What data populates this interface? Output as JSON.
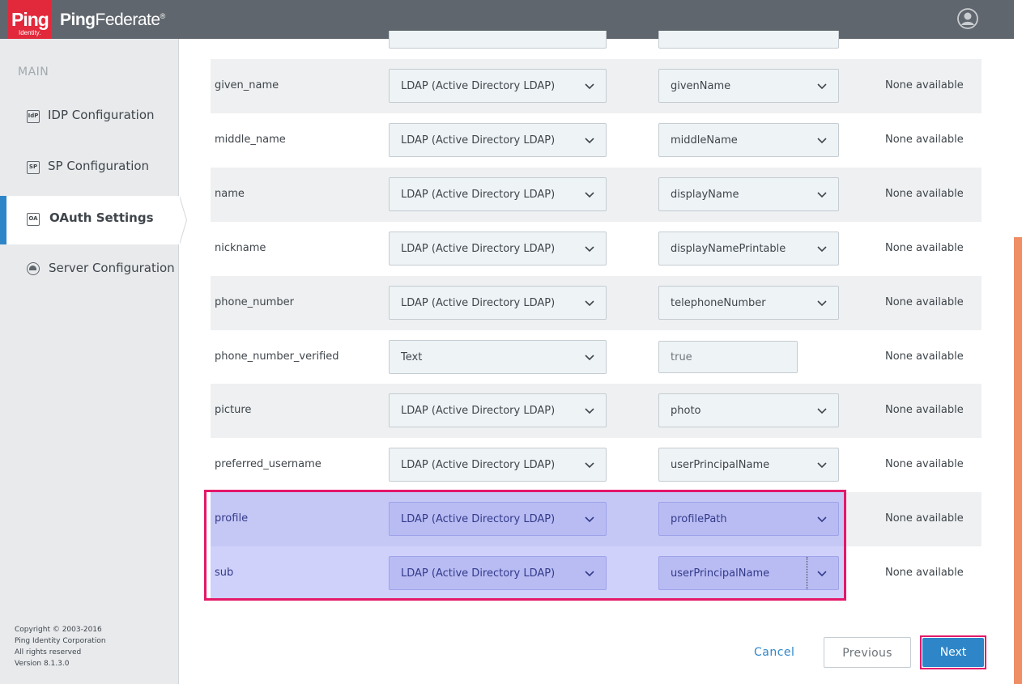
{
  "header": {
    "logo_main": "Ping",
    "logo_sub": "Identity.",
    "brand_ping": "Ping",
    "brand_federate": "Federate",
    "brand_mark": "®",
    "user_icon": "user-avatar-icon"
  },
  "sidebar": {
    "section_label": "MAIN",
    "items": [
      {
        "label": "IDP Configuration",
        "icon_text": "IdP",
        "active": false
      },
      {
        "label": "SP Configuration",
        "icon_text": "SP",
        "active": false
      },
      {
        "label": "OAuth Settings",
        "icon_text": "OA",
        "active": true
      },
      {
        "label": "Server Configuration",
        "icon": "server-icon",
        "active": false
      }
    ],
    "copyright": [
      "Copyright © 2003-2016",
      "Ping Identity Corporation",
      "All rights reserved",
      "Version 8.1.3.0"
    ]
  },
  "rows": [
    {
      "attr": "given_name",
      "source": "LDAP (Active Directory LDAP)",
      "value": "givenName",
      "value_type": "select",
      "status": "None available"
    },
    {
      "attr": "middle_name",
      "source": "LDAP (Active Directory LDAP)",
      "value": "middleName",
      "value_type": "select",
      "status": "None available"
    },
    {
      "attr": "name",
      "source": "LDAP (Active Directory LDAP)",
      "value": "displayName",
      "value_type": "select",
      "status": "None available"
    },
    {
      "attr": "nickname",
      "source": "LDAP (Active Directory LDAP)",
      "value": "displayNamePrintable",
      "value_type": "select",
      "status": "None available"
    },
    {
      "attr": "phone_number",
      "source": "LDAP (Active Directory LDAP)",
      "value": "telephoneNumber",
      "value_type": "select",
      "status": "None available"
    },
    {
      "attr": "phone_number_verified",
      "source": "Text",
      "value": "true",
      "value_type": "text",
      "status": "None available"
    },
    {
      "attr": "picture",
      "source": "LDAP (Active Directory LDAP)",
      "value": "photo",
      "value_type": "select",
      "status": "None available"
    },
    {
      "attr": "preferred_username",
      "source": "LDAP (Active Directory LDAP)",
      "value": "userPrincipalName",
      "value_type": "select",
      "status": "None available"
    },
    {
      "attr": "profile",
      "source": "LDAP (Active Directory LDAP)",
      "value": "profilePath",
      "value_type": "select",
      "status": "None available"
    },
    {
      "attr": "sub",
      "source": "LDAP (Active Directory LDAP)",
      "value": "userPrincipalName",
      "value_type": "select",
      "status": "None available"
    }
  ],
  "footer": {
    "cancel_label": "Cancel",
    "previous_label": "Previous",
    "next_label": "Next"
  },
  "colors": {
    "header_bg": "#5f666d",
    "brand_red": "#e2283b",
    "accent_blue": "#2e86c9",
    "highlight_pink": "#e4186a",
    "scroll_orange": "#ef8d65"
  }
}
